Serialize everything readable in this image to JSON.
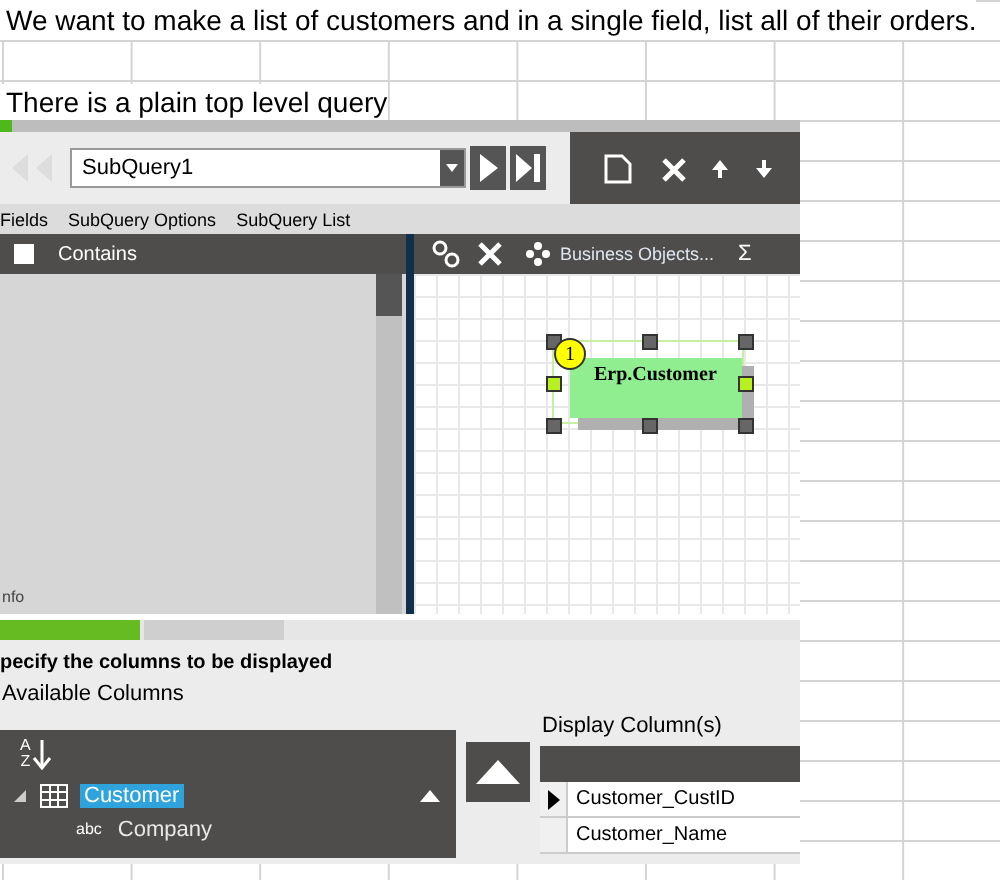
{
  "sheet": {
    "lines": [
      "We want to make a list of customers and in a single field, list all of their orders.",
      "There is a plain top level query"
    ]
  },
  "app": {
    "query_selector": {
      "value": "SubQuery1"
    },
    "menu": [
      "Fields",
      "SubQuery Options",
      "SubQuery List"
    ],
    "left_panel": {
      "checkbox": {
        "label": "Contains",
        "checked": false
      },
      "footer": "nfo"
    },
    "designer_toolbar": {
      "label": "Business Objects...",
      "sum_symbol": "Σ"
    },
    "diagram": {
      "nodes": [
        {
          "badge": "1",
          "label": "Erp.Customer",
          "selected": true
        }
      ]
    },
    "tabs": [
      {
        "selected": true
      },
      {
        "selected": false
      }
    ],
    "instruction": "pecify the columns to be displayed",
    "available": {
      "title": "Available Columns",
      "sort_letters": [
        "A",
        "Z"
      ],
      "tree": [
        {
          "label": "Customer",
          "selected": true,
          "expanded": true,
          "children": [
            {
              "type_tag": "abc",
              "label": "Company",
              "selected": false
            }
          ]
        }
      ]
    },
    "display": {
      "title": "Display Column(s)",
      "rows": [
        {
          "name": "Customer_CustID",
          "current": true
        },
        {
          "name": "Customer_Name",
          "current": false
        }
      ]
    }
  }
}
